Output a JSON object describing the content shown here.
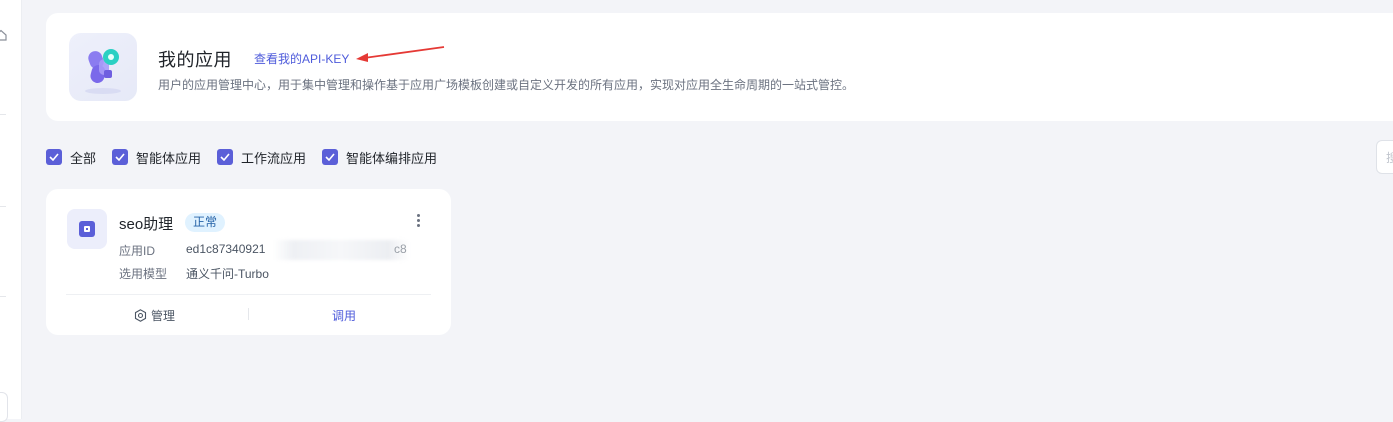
{
  "header": {
    "title": "我的应用",
    "api_key_link": "查看我的API-KEY",
    "description": "用户的应用管理中心，用于集中管理和操作基于应用广场模板创建或自定义开发的所有应用，实现对应用全生命周期的一站式管控。"
  },
  "filters": [
    {
      "label": "全部",
      "checked": true
    },
    {
      "label": "智能体应用",
      "checked": true
    },
    {
      "label": "工作流应用",
      "checked": true
    },
    {
      "label": "智能体编排应用",
      "checked": true
    }
  ],
  "search": {
    "glyph": "搜"
  },
  "apps": [
    {
      "name": "seo助理",
      "status": "正常",
      "id_label": "应用ID",
      "id_value": "ed1c87340921",
      "id_tail": "c8",
      "model_label": "选用模型",
      "model_value": "通义千问-Turbo",
      "manage_label": "管理",
      "invoke_label": "调用"
    }
  ],
  "colors": {
    "accent": "#5b5fd8",
    "link": "#4e5bdb",
    "status_bg": "#e0f2ff",
    "annotation_arrow": "#e53935"
  },
  "icons": [
    "home-icon",
    "app-logo-icon",
    "checkbox-checked-icon",
    "app-card-icon",
    "more-vertical-icon",
    "gear-icon",
    "search-icon"
  ]
}
